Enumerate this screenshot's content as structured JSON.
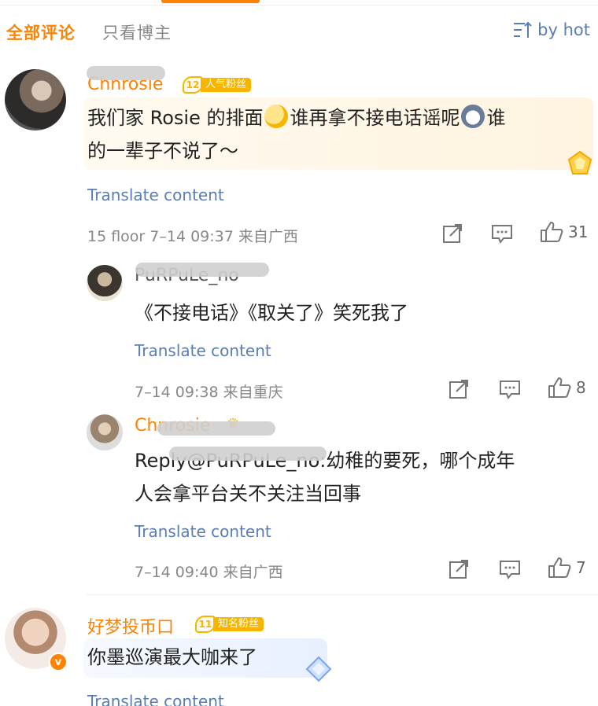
{
  "tabs": {
    "all": "全部评论",
    "blogger_only": "只看博主",
    "sort_label": "by hot"
  },
  "comments": [
    {
      "username": "Chnrosie",
      "badge_level": "12",
      "badge_text": "人气粉丝",
      "text_part1": "我们家 Rosie 的排面",
      "text_part2": "谁再拿不接电话谣呢",
      "text_part3": "谁",
      "text_line2": "的一辈子不说了～",
      "translate": "Translate content",
      "meta": "15 floor 7–14 09:37 来自广西",
      "likes": "31"
    }
  ],
  "replies": [
    {
      "username": "PuRPuLe_no",
      "text": "《不接电话》《取关了》笑死我了",
      "translate": "Translate content",
      "meta": "7–14 09:38 来自重庆",
      "likes": "8"
    },
    {
      "username": "Chnrosie",
      "text_line1": "Reply@PuRPuLe_no:幼稚的要死，哪个成年",
      "text_line2": "人会拿平台关不关注当回事",
      "translate": "Translate content",
      "meta": "7–14 09:40 来自广西",
      "likes": "7"
    }
  ],
  "next_comment": {
    "username": "好梦投币口",
    "badge_level": "11",
    "badge_text": "知名粉丝",
    "verified_mark": "v",
    "text": "你墨巡演最大咖来了",
    "translate": "Translate content"
  },
  "colors": {
    "accent": "#ff8200",
    "link": "#5b7db1",
    "meta": "#888888",
    "badge": "#f7b500"
  },
  "icons": [
    "sort-icon",
    "share-icon",
    "comment-icon",
    "like-icon",
    "medal-icon",
    "crown-icon"
  ]
}
